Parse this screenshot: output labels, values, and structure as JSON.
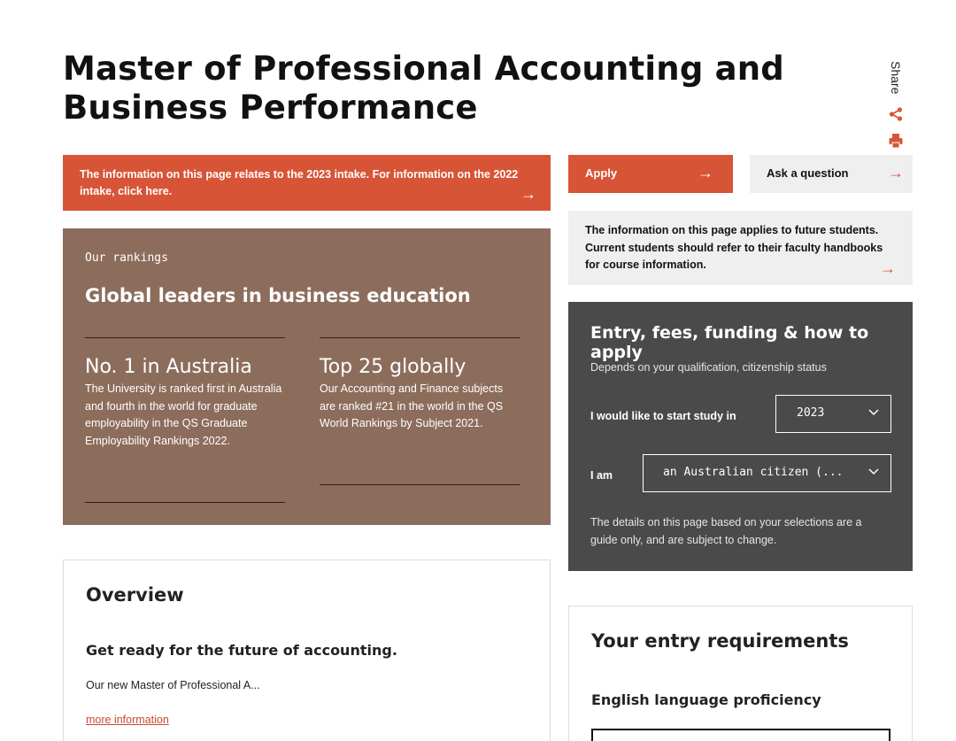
{
  "page": {
    "title": "Master of Professional Accounting and Business Performance"
  },
  "share": {
    "label": "Share",
    "icons": [
      "share-icon",
      "print-icon"
    ],
    "accent_color": "#d85436"
  },
  "intake_banner": {
    "text": "The information on this page relates to the 2023 intake. For information on the 2022 intake, click here.",
    "arrow": "→"
  },
  "rankings": {
    "eyebrow": "Our rankings",
    "heading": "Global leaders in business education",
    "items": [
      {
        "stat": "No. 1 in Australia",
        "description": "The University is ranked first in Australia and fourth in the world for graduate employability in the QS Graduate Employability Rankings 2022."
      },
      {
        "stat": "Top 25 globally",
        "description": "Our Accounting and Finance subjects are ranked #21 in the world in the QS World Rankings by Subject 2021."
      }
    ],
    "background_color": "#8c6d5c"
  },
  "overview": {
    "heading": "Overview",
    "subheading": "Get ready for the future of accounting.",
    "excerpt": "Our new Master of Professional A...",
    "more_link": "more information"
  },
  "actions": {
    "apply_label": "Apply",
    "ask_label": "Ask a question",
    "arrow": "→"
  },
  "future_note": {
    "text": "The information on this page applies to future students. Current students should refer to their faculty handbooks for course information.",
    "arrow": "→"
  },
  "entry": {
    "heading": "Entry, fees, funding & how to apply",
    "subtext": "Depends on your qualification, citizenship status",
    "start_label": "I would like to start study in",
    "start_value": "2023",
    "status_label": "I am",
    "status_value": "an Australian citizen (...",
    "note": "The details on this page based on your selections are a guide only, and are subject to change.",
    "background_color": "#4a4a4a"
  },
  "requirements": {
    "heading": "Your entry requirements",
    "subheading": "English language proficiency"
  }
}
